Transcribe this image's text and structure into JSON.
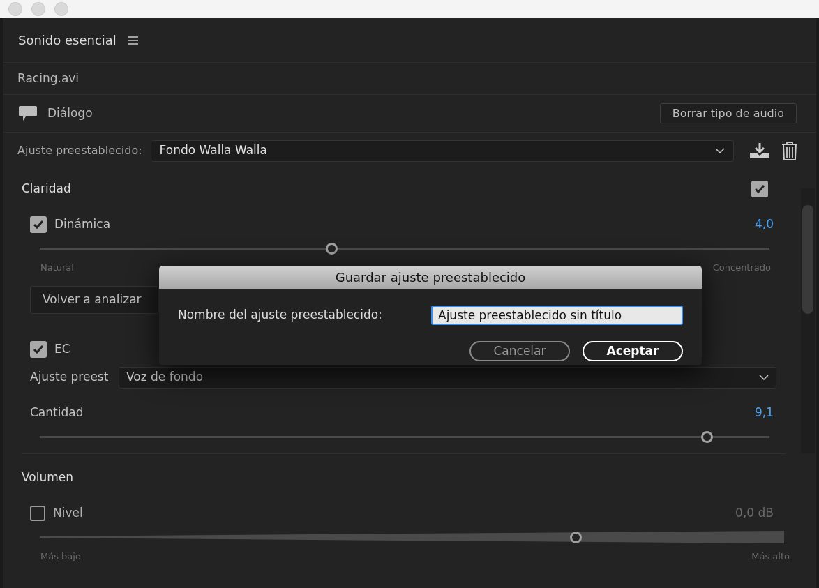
{
  "panel": {
    "title": "Sonido esencial",
    "clip": "Racing.avi",
    "audio_type": "Diálogo",
    "clear_button": "Borrar tipo de audio",
    "preset": {
      "label": "Ajuste preestablecido:",
      "value": "Fondo Walla Walla"
    }
  },
  "sections": [
    {
      "title": "Claridad",
      "enabled": true,
      "controls": [
        {
          "kind": "slider",
          "label": "Dinámica",
          "checked": true,
          "value": "4,0",
          "level": 0.4,
          "min_label": "Natural",
          "max_label": "Concentrado"
        },
        {
          "kind": "button",
          "label": "Volver a analizar"
        },
        {
          "kind": "checkbox",
          "label": "EC",
          "checked": true
        },
        {
          "kind": "dropdown",
          "label": "Ajuste preest",
          "value": "Voz de fondo"
        },
        {
          "kind": "slider",
          "label": "Cantidad",
          "value": "9,1",
          "level": 0.914
        }
      ]
    },
    {
      "title": "Volumen",
      "controls": [
        {
          "kind": "wedge",
          "label": "Nivel",
          "checked": false,
          "value": "0,0 dB",
          "level": 0.72,
          "min_label": "Más bajo",
          "max_label": "Más alto"
        }
      ]
    }
  ],
  "dialog": {
    "title": "Guardar ajuste preestablecido",
    "label": "Nombre del ajuste preestablecido:",
    "value": "Ajuste preestablecido sin título",
    "buttons": [
      {
        "label": "Cancelar",
        "default": false
      },
      {
        "label": "Aceptar",
        "default": true
      }
    ]
  }
}
